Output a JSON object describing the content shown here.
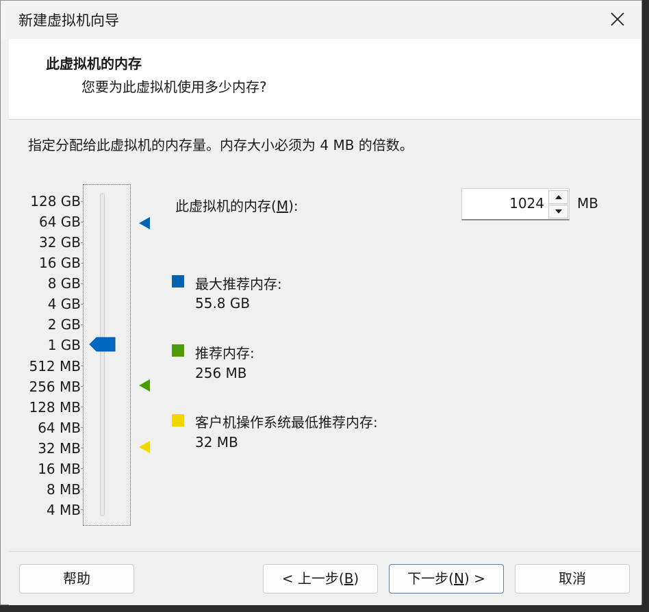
{
  "window": {
    "title": "新建虚拟机向导"
  },
  "header": {
    "title": "此虚拟机的内存",
    "subtitle": "您要为此虚拟机使用多少内存?"
  },
  "instruction": "指定分配给此虚拟机的内存量。内存大小必须为 4 MB 的倍数。",
  "memory_scale": [
    "128 GB",
    "64 GB",
    "32 GB",
    "16 GB",
    "8 GB",
    "4 GB",
    "2 GB",
    "1 GB",
    "512 MB",
    "256 MB",
    "128 MB",
    "64 MB",
    "32 MB",
    "16 MB",
    "8 MB",
    "4 MB"
  ],
  "slider": {
    "current_value": "1 GB"
  },
  "memory_field": {
    "label_prefix": "此虚拟机的内存(",
    "label_mnemonic": "M",
    "label_suffix": "):",
    "value": "1024",
    "unit": "MB"
  },
  "legend": [
    {
      "label": "最大推荐内存:",
      "value": "55.8 GB",
      "color": "#0063b1"
    },
    {
      "label": "推荐内存:",
      "value": "256 MB",
      "color": "#4e9a06"
    },
    {
      "label": "客户机操作系统最低推荐内存:",
      "value": "32 MB",
      "color": "#f2d600"
    }
  ],
  "buttons": {
    "help": "帮助",
    "back_prefix": "< 上一步(",
    "back_mnemonic": "B",
    "back_suffix": ")",
    "next_prefix": "下一步(",
    "next_mnemonic": "N",
    "next_suffix": ") >",
    "cancel": "取消"
  }
}
